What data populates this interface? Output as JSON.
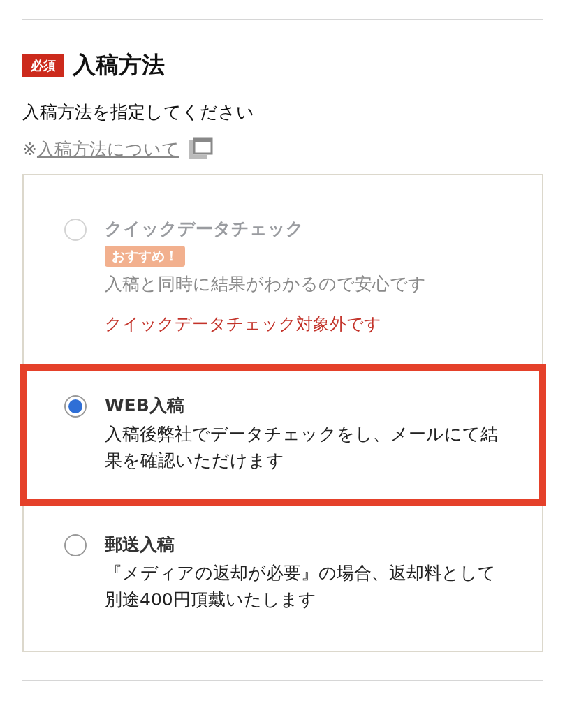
{
  "section": {
    "required_badge": "必須",
    "title": "入稿方法",
    "instruction": "入稿方法を指定してください",
    "note_prefix": "※",
    "help_link": "入稿方法について"
  },
  "options": [
    {
      "title": "クイックデータチェック",
      "badge": "おすすめ！",
      "description": "入稿と同時に結果がわかるので安心です",
      "warning": "クイックデータチェック対象外です",
      "selected": false,
      "disabled": true,
      "highlighted": false
    },
    {
      "title": "WEB入稿",
      "description": "入稿後弊社でデータチェックをし、メールにて結果を確認いただけます",
      "selected": true,
      "disabled": false,
      "highlighted": true
    },
    {
      "title": "郵送入稿",
      "description": "『メディアの返却が必要』の場合、返却料として別途400円頂戴いたします",
      "selected": false,
      "disabled": false,
      "highlighted": false
    }
  ]
}
